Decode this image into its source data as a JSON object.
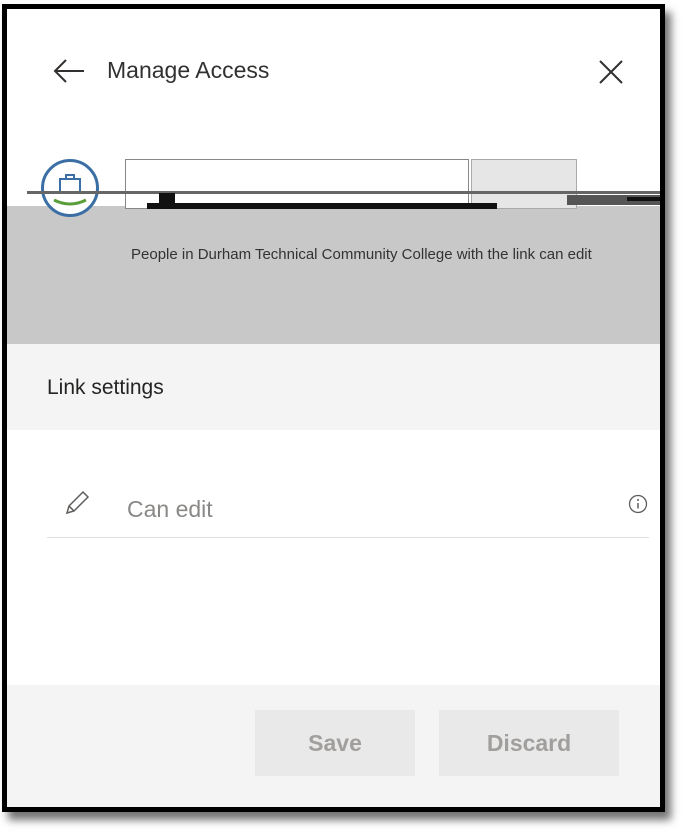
{
  "header": {
    "title": "Manage Access",
    "back_icon": "arrow-left-icon",
    "close_icon": "close-icon"
  },
  "link": {
    "description": "People in Durham Technical Community College with the link can edit",
    "avatar_icon": "organization-icon",
    "copy_icon": "copy-icon"
  },
  "settings": {
    "title": "Link settings",
    "permission_label": "Can edit",
    "permission_icon": "pencil-icon",
    "info_icon": "info-icon"
  },
  "footer": {
    "save_label": "Save",
    "discard_label": "Discard"
  }
}
